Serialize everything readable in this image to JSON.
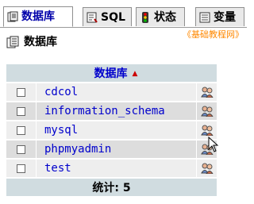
{
  "tabs": [
    {
      "label": "数据库",
      "icon": "database-icon",
      "active": true
    },
    {
      "label": "SQL",
      "icon": "sql-icon",
      "active": false
    },
    {
      "label": "状态",
      "icon": "status-icon",
      "active": false
    },
    {
      "label": "变量",
      "icon": "variables-icon",
      "active": false
    }
  ],
  "heading": "数据库",
  "watermark": "《基础教程网》",
  "table": {
    "column_header": "数据库",
    "rows": [
      {
        "name": "cdcol"
      },
      {
        "name": "information_schema"
      },
      {
        "name": "mysql"
      },
      {
        "name": "phpmyadmin"
      },
      {
        "name": "test"
      }
    ],
    "footer": "统计: 5"
  },
  "colors": {
    "link": "#0000cc",
    "header_bg": "#d0dce0",
    "accent": "#ff8800"
  }
}
